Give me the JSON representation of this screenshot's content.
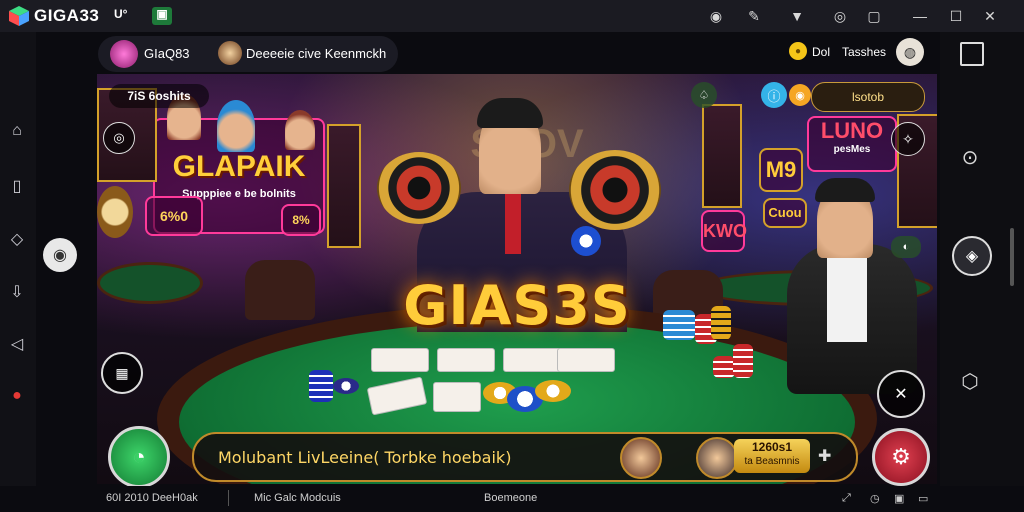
{
  "titlebar": {
    "app_name": "GIGA33",
    "badge1": "U°",
    "badge2": "▣"
  },
  "header": {
    "profile_name": "GIaQ83",
    "channel_text": "Deeeeie cive Keenmckh",
    "coins": "Dol",
    "tasks": "Tasshes"
  },
  "stage": {
    "top_left_label": "7iS 6oshits",
    "sign_left": "GLAPAIK",
    "sign_left_sub": "Supppiee e be bolnits",
    "sign_left_badge": "6%0",
    "sign_left_badge2": "8%",
    "sign_right_1": "LUNO",
    "sign_right_1b": "pesMes",
    "sign_right_2": "M9",
    "sign_right_3": "KWO",
    "sign_right_4": "Cuou",
    "top_right_label": "lsotob",
    "logo": "GIAS3S",
    "bg_text": "SNOV"
  },
  "bottom_bar": {
    "message": "Molubant LivLeeine( Torbke hoebaik)",
    "balance_line1": "1260s1",
    "balance_line2": "ta Beasmnis"
  },
  "statusbar": {
    "left": "60I 2010 DeeH0ak",
    "mid": "Mic Galc Modcuis",
    "center": "Boemeone"
  }
}
